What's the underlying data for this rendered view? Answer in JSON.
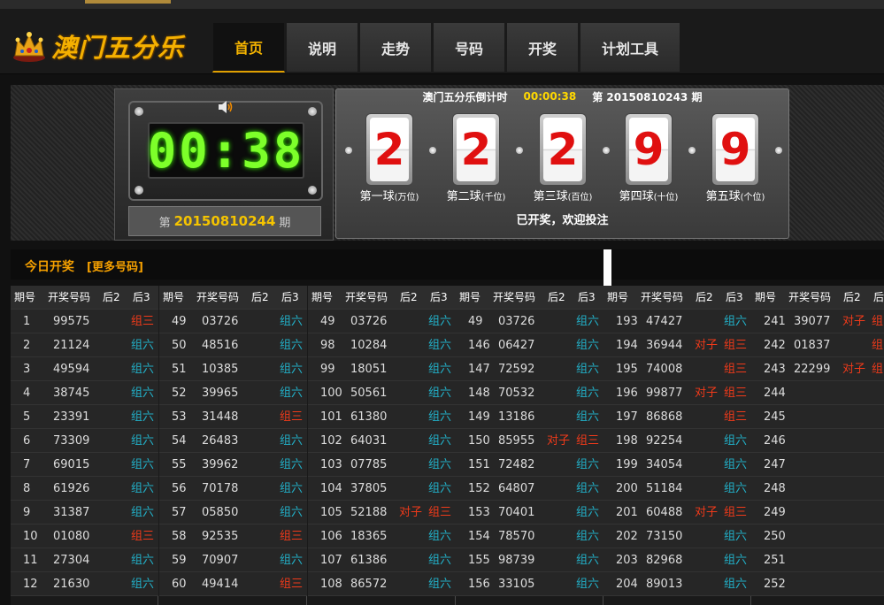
{
  "app": {
    "title": "澳门五分乐",
    "colors": {
      "accent": "#f5b400",
      "pair": "#f03a1a",
      "group6": "#22b0c8"
    }
  },
  "nav": {
    "tabs": [
      {
        "label": "首页",
        "active": true
      },
      {
        "label": "说明"
      },
      {
        "label": "走势"
      },
      {
        "label": "号码"
      },
      {
        "label": "开奖"
      },
      {
        "label": "计划工具"
      }
    ]
  },
  "timer": {
    "clock": "00:38",
    "next_prefix": "第",
    "next_issue": "20150810244",
    "next_suffix": "期",
    "icon": "speaker-icon"
  },
  "result": {
    "header_label": "澳门五分乐倒计时",
    "header_countdown": "00:00:38",
    "header_issue": "第 20150810243 期",
    "balls": [
      {
        "value": "2",
        "label": "第一球",
        "sub": "(万位)"
      },
      {
        "value": "2",
        "label": "第二球",
        "sub": "(千位)"
      },
      {
        "value": "2",
        "label": "第三球",
        "sub": "(百位)"
      },
      {
        "value": "9",
        "label": "第四球",
        "sub": "(十位)"
      },
      {
        "value": "9",
        "label": "第五球",
        "sub": "(个位)"
      }
    ],
    "message": "已开奖，欢迎投注"
  },
  "today": {
    "title": "今日开奖",
    "more": "[更多号码]",
    "headers": [
      "期号",
      "开奖号码",
      "后2",
      "后3"
    ],
    "columns": [
      [
        [
          "1",
          "99575",
          "",
          "组三"
        ],
        [
          "2",
          "21124",
          "",
          "组六"
        ],
        [
          "3",
          "49594",
          "",
          "组六"
        ],
        [
          "4",
          "38745",
          "",
          "组六"
        ],
        [
          "5",
          "23391",
          "",
          "组六"
        ],
        [
          "6",
          "73309",
          "",
          "组六"
        ],
        [
          "7",
          "69015",
          "",
          "组六"
        ],
        [
          "8",
          "61926",
          "",
          "组六"
        ],
        [
          "9",
          "31387",
          "",
          "组六"
        ],
        [
          "10",
          "01080",
          "",
          "组三"
        ],
        [
          "11",
          "27304",
          "",
          "组六"
        ],
        [
          "12",
          "21630",
          "",
          "组六"
        ]
      ],
      [
        [
          "49",
          "03726",
          "",
          "组六"
        ],
        [
          "50",
          "48516",
          "",
          "组六"
        ],
        [
          "51",
          "10385",
          "",
          "组六"
        ],
        [
          "52",
          "39965",
          "",
          "组六"
        ],
        [
          "53",
          "31448",
          "",
          "组三"
        ],
        [
          "54",
          "26483",
          "",
          "组六"
        ],
        [
          "55",
          "39962",
          "",
          "组六"
        ],
        [
          "56",
          "70178",
          "",
          "组六"
        ],
        [
          "57",
          "05850",
          "",
          "组六"
        ],
        [
          "58",
          "92535",
          "",
          "组三"
        ],
        [
          "59",
          "70907",
          "",
          "组六"
        ],
        [
          "60",
          "49414",
          "",
          "组三"
        ]
      ],
      [
        [
          "49",
          "03726",
          "",
          "组六"
        ],
        [
          "98",
          "10284",
          "",
          "组六"
        ],
        [
          "99",
          "18051",
          "",
          "组六"
        ],
        [
          "100",
          "50561",
          "",
          "组六"
        ],
        [
          "101",
          "61380",
          "",
          "组六"
        ],
        [
          "102",
          "64031",
          "",
          "组六"
        ],
        [
          "103",
          "07785",
          "",
          "组六"
        ],
        [
          "104",
          "37805",
          "",
          "组六"
        ],
        [
          "105",
          "52188",
          "对子",
          "组三"
        ],
        [
          "106",
          "18365",
          "",
          "组六"
        ],
        [
          "107",
          "61386",
          "",
          "组六"
        ],
        [
          "108",
          "86572",
          "",
          "组六"
        ]
      ],
      [
        [
          "49",
          "03726",
          "",
          "组六"
        ],
        [
          "146",
          "06427",
          "",
          "组六"
        ],
        [
          "147",
          "72592",
          "",
          "组六"
        ],
        [
          "148",
          "70532",
          "",
          "组六"
        ],
        [
          "149",
          "13186",
          "",
          "组六"
        ],
        [
          "150",
          "85955",
          "对子",
          "组三"
        ],
        [
          "151",
          "72482",
          "",
          "组六"
        ],
        [
          "152",
          "64807",
          "",
          "组六"
        ],
        [
          "153",
          "70401",
          "",
          "组六"
        ],
        [
          "154",
          "78570",
          "",
          "组六"
        ],
        [
          "155",
          "98739",
          "",
          "组六"
        ],
        [
          "156",
          "33105",
          "",
          "组六"
        ]
      ],
      [
        [
          "193",
          "47427",
          "",
          "组六"
        ],
        [
          "194",
          "36944",
          "对子",
          "组三"
        ],
        [
          "195",
          "74008",
          "",
          "组三"
        ],
        [
          "196",
          "99877",
          "对子",
          "组三"
        ],
        [
          "197",
          "86868",
          "",
          "组三"
        ],
        [
          "198",
          "92254",
          "",
          "组六"
        ],
        [
          "199",
          "34054",
          "",
          "组六"
        ],
        [
          "200",
          "51184",
          "",
          "组六"
        ],
        [
          "201",
          "60488",
          "对子",
          "组三"
        ],
        [
          "202",
          "73150",
          "",
          "组六"
        ],
        [
          "203",
          "82968",
          "",
          "组六"
        ],
        [
          "204",
          "89013",
          "",
          "组六"
        ]
      ],
      [
        [
          "241",
          "39077",
          "对子",
          "组"
        ],
        [
          "242",
          "01837",
          "",
          "组"
        ],
        [
          "243",
          "22299",
          "对子",
          "组"
        ],
        [
          "244",
          "",
          "",
          ""
        ],
        [
          "245",
          "",
          "",
          ""
        ],
        [
          "246",
          "",
          "",
          ""
        ],
        [
          "247",
          "",
          "",
          ""
        ],
        [
          "248",
          "",
          "",
          ""
        ],
        [
          "249",
          "",
          "",
          ""
        ],
        [
          "250",
          "",
          "",
          ""
        ],
        [
          "251",
          "",
          "",
          ""
        ],
        [
          "252",
          "",
          "",
          ""
        ]
      ]
    ]
  }
}
